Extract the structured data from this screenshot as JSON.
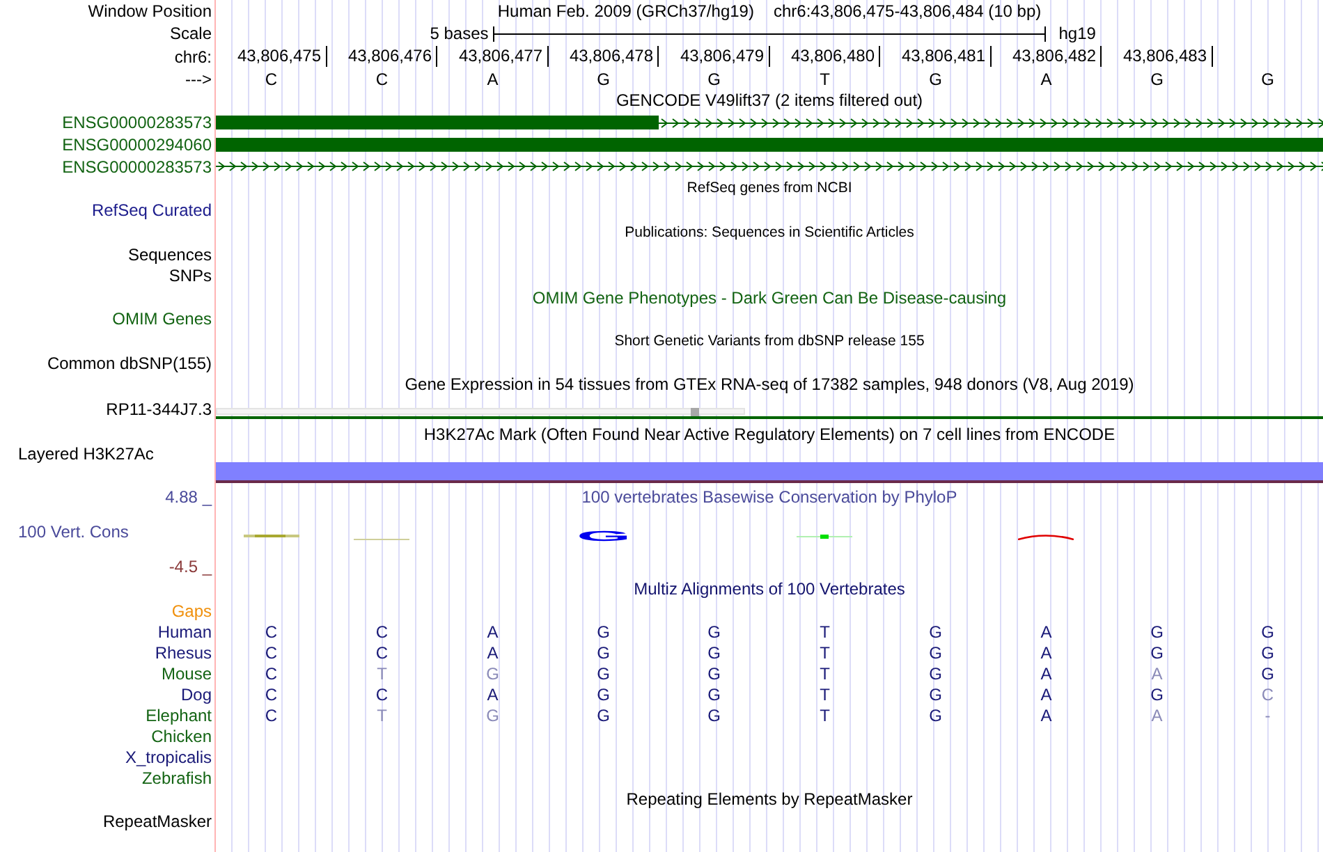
{
  "window_position": {
    "label": "Window Position",
    "assembly": "Human Feb. 2009 (GRCh37/hg19)",
    "position": "chr6:43,806,475-43,806,484 (10 bp)"
  },
  "scale": {
    "label": "Scale",
    "span": "5 bases",
    "assembly": "hg19"
  },
  "ruler": {
    "label": "chr6:",
    "ticks": [
      "43,806,475",
      "43,806,476",
      "43,806,477",
      "43,806,478",
      "43,806,479",
      "43,806,480",
      "43,806,481",
      "43,806,482",
      "43,806,483"
    ]
  },
  "sequence": {
    "label": "--->",
    "bases": [
      "C",
      "C",
      "A",
      "G",
      "G",
      "T",
      "G",
      "A",
      "G",
      "G"
    ]
  },
  "gencode": {
    "title": "GENCODE V49lift37 (2 items filtered out)",
    "genes": [
      {
        "name": "ENSG00000283573",
        "kind": "partial"
      },
      {
        "name": "ENSG00000294060",
        "kind": "full"
      },
      {
        "name": "ENSG00000283573",
        "kind": "intron"
      }
    ]
  },
  "refseq": {
    "title": "RefSeq genes from NCBI",
    "label": "RefSeq Curated"
  },
  "publications": {
    "title": "Publications: Sequences in Scientific Articles",
    "labels": [
      "Sequences",
      "SNPs"
    ]
  },
  "omim": {
    "title": "OMIM Gene Phenotypes - Dark Green Can Be Disease-causing",
    "label": "OMIM Genes"
  },
  "dbsnp": {
    "title": "Short Genetic Variants from dbSNP release 155",
    "label": "Common dbSNP(155)"
  },
  "gtex": {
    "title": "Gene Expression in 54 tissues from GTEx RNA-seq of 17382 samples, 948 donors (V8, Aug 2019)",
    "label": "RP11-344J7.3"
  },
  "h3k27ac": {
    "title": "H3K27Ac Mark (Often Found Near Active Regulatory Elements) on 7 cell lines from ENCODE",
    "label": "Layered H3K27Ac"
  },
  "conservation": {
    "title": "100 vertebrates Basewise Conservation by PhyloP",
    "label": "100 Vert. Cons",
    "max": "4.88 _",
    "min": "-4.5 _",
    "logo_letter": "G"
  },
  "multiz": {
    "title": "Multiz Alignments of 100 Vertebrates",
    "gaps_label": "Gaps",
    "species": [
      {
        "name": "Human",
        "color": "#1a1a78",
        "bases": [
          {
            "base": "C",
            "match": true
          },
          {
            "base": "C",
            "match": true
          },
          {
            "base": "A",
            "match": true
          },
          {
            "base": "G",
            "match": true
          },
          {
            "base": "G",
            "match": true
          },
          {
            "base": "T",
            "match": true
          },
          {
            "base": "G",
            "match": true
          },
          {
            "base": "A",
            "match": true
          },
          {
            "base": "G",
            "match": true
          },
          {
            "base": "G",
            "match": true
          }
        ]
      },
      {
        "name": "Rhesus",
        "color": "#1a1a78",
        "bases": [
          {
            "base": "C",
            "match": true
          },
          {
            "base": "C",
            "match": true
          },
          {
            "base": "A",
            "match": true
          },
          {
            "base": "G",
            "match": true
          },
          {
            "base": "G",
            "match": true
          },
          {
            "base": "T",
            "match": true
          },
          {
            "base": "G",
            "match": true
          },
          {
            "base": "A",
            "match": true
          },
          {
            "base": "G",
            "match": true
          },
          {
            "base": "G",
            "match": true
          }
        ]
      },
      {
        "name": "Mouse",
        "color": "#146414",
        "bases": [
          {
            "base": "C",
            "match": true
          },
          {
            "base": "T",
            "match": false
          },
          {
            "base": "G",
            "match": false
          },
          {
            "base": "G",
            "match": true
          },
          {
            "base": "G",
            "match": true
          },
          {
            "base": "T",
            "match": true
          },
          {
            "base": "G",
            "match": true
          },
          {
            "base": "A",
            "match": true
          },
          {
            "base": "A",
            "match": false
          },
          {
            "base": "G",
            "match": true
          }
        ]
      },
      {
        "name": "Dog",
        "color": "#1a1a78",
        "bases": [
          {
            "base": "C",
            "match": true
          },
          {
            "base": "C",
            "match": true
          },
          {
            "base": "A",
            "match": true
          },
          {
            "base": "G",
            "match": true
          },
          {
            "base": "G",
            "match": true
          },
          {
            "base": "T",
            "match": true
          },
          {
            "base": "G",
            "match": true
          },
          {
            "base": "A",
            "match": true
          },
          {
            "base": "G",
            "match": true
          },
          {
            "base": "C",
            "match": false
          }
        ]
      },
      {
        "name": "Elephant",
        "color": "#146414",
        "bases": [
          {
            "base": "C",
            "match": true
          },
          {
            "base": "T",
            "match": false
          },
          {
            "base": "G",
            "match": false
          },
          {
            "base": "G",
            "match": true
          },
          {
            "base": "G",
            "match": true
          },
          {
            "base": "T",
            "match": true
          },
          {
            "base": "G",
            "match": true
          },
          {
            "base": "A",
            "match": true
          },
          {
            "base": "A",
            "match": false
          },
          {
            "base": "-",
            "match": false
          }
        ]
      },
      {
        "name": "Chicken",
        "color": "#146414"
      },
      {
        "name": "X_tropicalis",
        "color": "#1a1a78"
      },
      {
        "name": "Zebrafish",
        "color": "#146414"
      }
    ]
  },
  "repeatmasker": {
    "title": "Repeating Elements by RepeatMasker",
    "label": "RepeatMasker"
  }
}
